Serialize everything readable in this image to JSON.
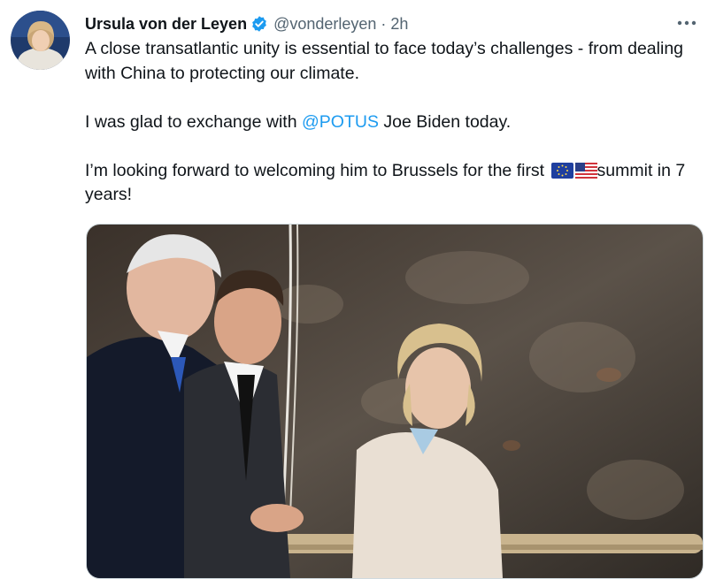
{
  "tweet": {
    "display_name": "Ursula von der Leyen",
    "handle": "@vonderleyen",
    "separator": "·",
    "timestamp": "2h",
    "avatar_icon": "avatar-photo",
    "verified_icon": "verified-badge-icon",
    "more_icon": "more-options-icon",
    "text": {
      "p1": "A close transatlantic unity is essential to face today’s challenges - from dealing with China to protecting our climate.",
      "p2_before": "I was glad to exchange with ",
      "p2_mention": "@POTUS",
      "p2_after": " Joe Biden today.",
      "p3_before": "I’m looking forward to welcoming him to Brussels for the first ",
      "p3_after": "summit in 7 years!"
    },
    "flags": [
      "eu-flag-icon",
      "us-flag-icon"
    ],
    "media_icon": "photo-three-leaders"
  },
  "colors": {
    "text": "#0f1419",
    "secondary": "#536471",
    "link": "#1d9bf0",
    "verified": "#1d9bf0"
  }
}
